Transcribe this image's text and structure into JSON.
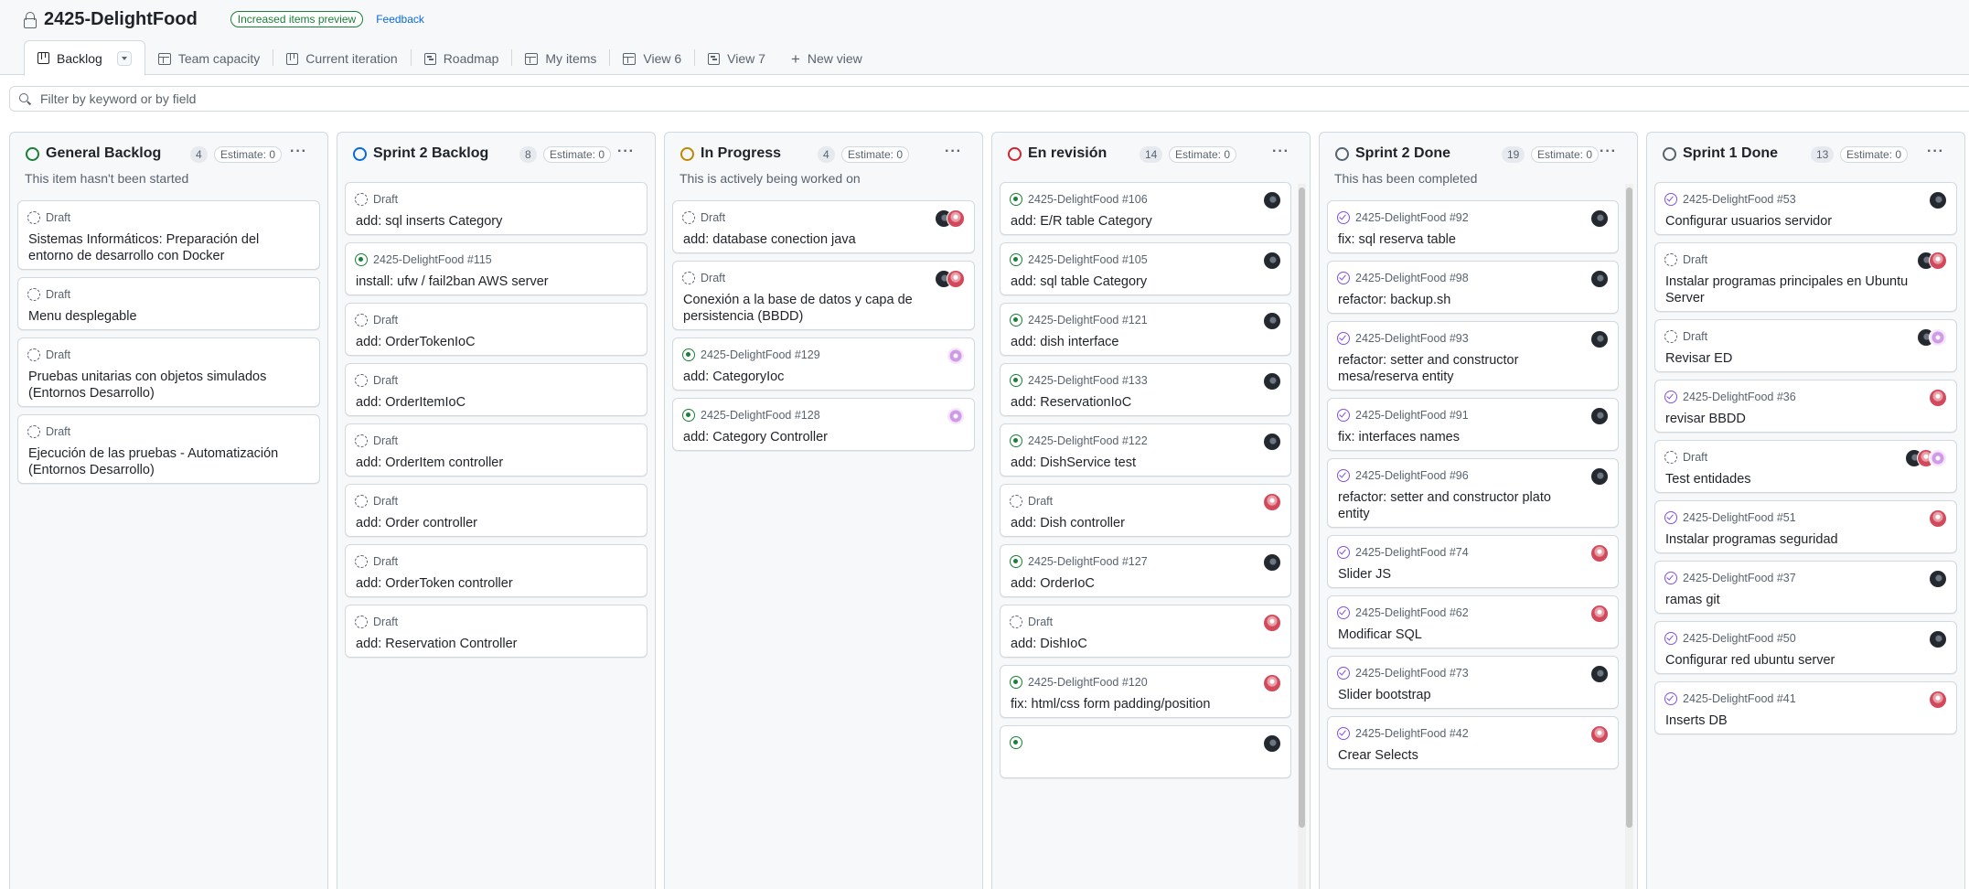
{
  "header": {
    "project_title": "2425-DelightFood",
    "preview_badge": "Increased items preview",
    "feedback_link": "Feedback"
  },
  "tabs": [
    {
      "label": "Backlog",
      "icon": "board-icon",
      "active": true
    },
    {
      "label": "Team capacity",
      "icon": "table-icon"
    },
    {
      "label": "Current iteration",
      "icon": "board-icon"
    },
    {
      "label": "Roadmap",
      "icon": "roadmap-icon"
    },
    {
      "label": "My items",
      "icon": "table-icon"
    },
    {
      "label": "View 6",
      "icon": "table-icon"
    },
    {
      "label": "View 7",
      "icon": "roadmap-icon"
    },
    {
      "label": "New view",
      "icon": "plus-icon"
    }
  ],
  "filter": {
    "placeholder": "Filter by keyword or by field",
    "value": ""
  },
  "colors": {
    "open": "#1a7f37",
    "closed": "#8250df",
    "todo": "#1a7f37",
    "sprint": "#0969da",
    "progress": "#bf8700",
    "review": "#d1242f",
    "done": "#59636e"
  },
  "columns": [
    {
      "name": "General Backlog",
      "count": "4",
      "estimate": "Estimate: 0",
      "description": "This item hasn't been started",
      "status_color": "#1a7f37",
      "cards": [
        {
          "meta": "Draft",
          "state": "draft",
          "title": "Sistemas Informáticos: Preparación del entorno de desarrollo con Docker",
          "avatars": []
        },
        {
          "meta": "Draft",
          "state": "draft",
          "title": "Menu desplegable",
          "avatars": []
        },
        {
          "meta": "Draft",
          "state": "draft",
          "title": "Pruebas unitarias con objetos simulados (Entornos Desarrollo)",
          "avatars": []
        },
        {
          "meta": "Draft",
          "state": "draft",
          "title": "Ejecución de las pruebas - Automatización (Entornos Desarrollo)",
          "avatars": []
        }
      ]
    },
    {
      "name": "Sprint 2 Backlog",
      "count": "8",
      "estimate": "Estimate: 0",
      "description": "",
      "status_color": "#0969da",
      "cards": [
        {
          "meta": "Draft",
          "state": "draft",
          "title": "add: sql inserts Category",
          "avatars": []
        },
        {
          "meta": "2425-DelightFood #115",
          "state": "open",
          "title": "install: ufw / fail2ban AWS server",
          "avatars": []
        },
        {
          "meta": "Draft",
          "state": "draft",
          "title": "add: OrderTokenIoC",
          "avatars": []
        },
        {
          "meta": "Draft",
          "state": "draft",
          "title": "add: OrderItemIoC",
          "avatars": []
        },
        {
          "meta": "Draft",
          "state": "draft",
          "title": "add: OrderItem controller",
          "avatars": []
        },
        {
          "meta": "Draft",
          "state": "draft",
          "title": "add: Order controller",
          "avatars": []
        },
        {
          "meta": "Draft",
          "state": "draft",
          "title": "add: OrderToken controller",
          "avatars": []
        },
        {
          "meta": "Draft",
          "state": "draft",
          "title": "add: Reservation Controller",
          "avatars": []
        }
      ]
    },
    {
      "name": "In Progress",
      "count": "4",
      "estimate": "Estimate: 0",
      "description": "This is actively being worked on",
      "status_color": "#bf8700",
      "cards": [
        {
          "meta": "Draft",
          "state": "draft",
          "title": "add: database conection java",
          "avatars": [
            "dark",
            "red"
          ]
        },
        {
          "meta": "Draft",
          "state": "draft",
          "title": "Conexión a la base de datos y capa de persistencia (BBDD)",
          "avatars": [
            "dark",
            "red"
          ]
        },
        {
          "meta": "2425-DelightFood #129",
          "state": "open",
          "title": "add: CategoryIoc",
          "avatars": [
            "pink"
          ]
        },
        {
          "meta": "2425-DelightFood #128",
          "state": "open",
          "title": "add: Category Controller",
          "avatars": [
            "pink"
          ]
        }
      ]
    },
    {
      "name": "En revisión",
      "count": "14",
      "estimate": "Estimate: 0",
      "description": "",
      "status_color": "#d1242f",
      "cards": [
        {
          "meta": "2425-DelightFood #106",
          "state": "open",
          "title": "add: E/R table Category",
          "avatars": [
            "dark"
          ]
        },
        {
          "meta": "2425-DelightFood #105",
          "state": "open",
          "title": "add: sql table Category",
          "avatars": [
            "dark"
          ]
        },
        {
          "meta": "2425-DelightFood #121",
          "state": "open",
          "title": "add: dish interface",
          "avatars": [
            "dark"
          ]
        },
        {
          "meta": "2425-DelightFood #133",
          "state": "open",
          "title": "add: ReservationIoC",
          "avatars": [
            "dark"
          ]
        },
        {
          "meta": "2425-DelightFood #122",
          "state": "open",
          "title": "add: DishService test",
          "avatars": [
            "dark"
          ]
        },
        {
          "meta": "Draft",
          "state": "draft",
          "title": "add: Dish controller",
          "avatars": [
            "red"
          ]
        },
        {
          "meta": "2425-DelightFood #127",
          "state": "open",
          "title": "add: OrderIoC",
          "avatars": [
            "dark"
          ]
        },
        {
          "meta": "Draft",
          "state": "draft",
          "title": "add: DishIoC",
          "avatars": [
            "red"
          ]
        },
        {
          "meta": "2425-DelightFood #120",
          "state": "open",
          "title": "fix: html/css form padding/position",
          "avatars": [
            "red"
          ]
        },
        {
          "meta": "",
          "state": "open",
          "title": "",
          "avatars": [
            "dark"
          ]
        }
      ]
    },
    {
      "name": "Sprint 2 Done",
      "count": "19",
      "estimate": "Estimate: 0",
      "description": "This has been completed",
      "status_color": "#59636e",
      "cards": [
        {
          "meta": "2425-DelightFood #92",
          "state": "closed",
          "title": "fix: sql reserva table",
          "avatars": [
            "dark"
          ]
        },
        {
          "meta": "2425-DelightFood #98",
          "state": "closed",
          "title": "refactor: backup.sh",
          "avatars": [
            "dark"
          ]
        },
        {
          "meta": "2425-DelightFood #93",
          "state": "closed",
          "title": "refactor: setter and constructor mesa/reserva entity",
          "avatars": [
            "dark"
          ]
        },
        {
          "meta": "2425-DelightFood #91",
          "state": "closed",
          "title": "fix: interfaces names",
          "avatars": [
            "dark"
          ]
        },
        {
          "meta": "2425-DelightFood #96",
          "state": "closed",
          "title": "refactor: setter and constructor plato entity",
          "avatars": [
            "dark"
          ]
        },
        {
          "meta": "2425-DelightFood #74",
          "state": "closed",
          "title": "Slider JS",
          "avatars": [
            "red"
          ]
        },
        {
          "meta": "2425-DelightFood #62",
          "state": "closed",
          "title": "Modificar SQL",
          "avatars": [
            "red"
          ]
        },
        {
          "meta": "2425-DelightFood #73",
          "state": "closed",
          "title": "Slider bootstrap",
          "avatars": [
            "dark"
          ]
        },
        {
          "meta": "2425-DelightFood #42",
          "state": "closed",
          "title": "Crear Selects",
          "avatars": [
            "red"
          ]
        }
      ]
    },
    {
      "name": "Sprint 1 Done",
      "count": "13",
      "estimate": "Estimate: 0",
      "description": "",
      "status_color": "#59636e",
      "cards": [
        {
          "meta": "2425-DelightFood #53",
          "state": "closed",
          "title": "Configurar usuarios servidor",
          "avatars": [
            "dark"
          ]
        },
        {
          "meta": "Draft",
          "state": "draft",
          "title": "Instalar programas principales en Ubuntu Server",
          "avatars": [
            "dark",
            "red"
          ]
        },
        {
          "meta": "Draft",
          "state": "draft",
          "title": "Revisar ED",
          "avatars": [
            "dark",
            "pink"
          ]
        },
        {
          "meta": "2425-DelightFood #36",
          "state": "closed",
          "title": "revisar BBDD",
          "avatars": [
            "red"
          ]
        },
        {
          "meta": "Draft",
          "state": "draft",
          "title": "Test entidades",
          "avatars": [
            "dark",
            "red",
            "pink"
          ]
        },
        {
          "meta": "2425-DelightFood #51",
          "state": "closed",
          "title": "Instalar programas seguridad",
          "avatars": [
            "red"
          ]
        },
        {
          "meta": "2425-DelightFood #37",
          "state": "closed",
          "title": "ramas git",
          "avatars": [
            "dark"
          ]
        },
        {
          "meta": "2425-DelightFood #50",
          "state": "closed",
          "title": "Configurar red ubuntu server",
          "avatars": [
            "dark"
          ]
        },
        {
          "meta": "2425-DelightFood #41",
          "state": "closed",
          "title": "Inserts DB",
          "avatars": [
            "red"
          ]
        }
      ]
    }
  ]
}
